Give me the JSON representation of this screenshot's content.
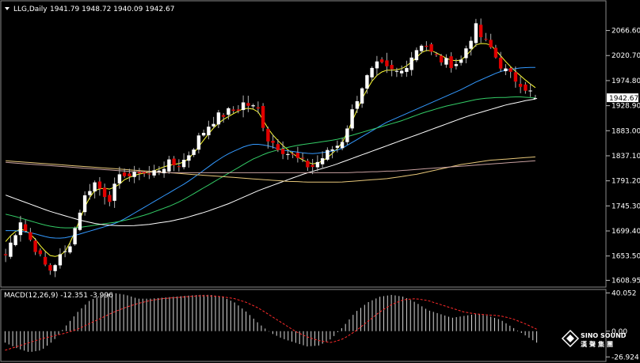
{
  "chart_data": [
    {
      "type": "candlestick",
      "symbol": "LLG,Daily",
      "ohlc_header": "1941.79 1948.72 1940.09 1942.67",
      "ohlc": {
        "open": 1941.79,
        "high": 1948.72,
        "low": 1940.09,
        "close": 1942.67
      },
      "current_price": "1942.67",
      "y_ticks": [
        "2066.60",
        "2020.70",
        "1974.80",
        "1928.90",
        "1883.00",
        "1837.10",
        "1791.20",
        "1745.30",
        "1699.40",
        "1653.50",
        "1608.95"
      ],
      "ylim": [
        1600.9,
        2093.5
      ],
      "bar_count": 108,
      "close_path": [
        1655,
        1688,
        1720,
        1690,
        1668,
        1640,
        1628,
        1648,
        1660,
        1690,
        1740,
        1775,
        1788,
        1770,
        1760,
        1790,
        1808,
        1795,
        1812,
        1802,
        1808,
        1818,
        1822,
        1820,
        1830,
        1850,
        1872,
        1890,
        1905,
        1912,
        1918,
        1922,
        1935,
        1926,
        1920,
        1870,
        1860,
        1850,
        1840,
        1832,
        1822,
        1816,
        1828,
        1840,
        1852,
        1862,
        1900,
        1940,
        1972,
        1990,
        2005,
        1995,
        1990,
        1990,
        2012,
        2032,
        2048,
        2025,
        2015,
        2008,
        2006,
        2010,
        2045,
        2072,
        2048,
        2035,
        2010,
        1992,
        1980,
        1972,
        1958,
        1942.67
      ],
      "candle_colors": {
        "up": "#ffffff",
        "down": "#e00000",
        "wick": "#b0b0b0"
      },
      "moving_averages": [
        {
          "color": "#ffff33",
          "values": [
            1680,
            1696,
            1703,
            1698,
            1684,
            1666,
            1654,
            1652,
            1662,
            1688,
            1722,
            1756,
            1774,
            1778,
            1776,
            1782,
            1794,
            1800,
            1804,
            1806,
            1810,
            1816,
            1820,
            1822,
            1826,
            1838,
            1856,
            1874,
            1890,
            1902,
            1910,
            1918,
            1924,
            1924,
            1916,
            1890,
            1872,
            1858,
            1846,
            1836,
            1828,
            1822,
            1824,
            1832,
            1844,
            1858,
            1886,
            1918,
            1948,
            1972,
            1988,
            1994,
            1994,
            1996,
            2004,
            2016,
            2030,
            2030,
            2024,
            2016,
            2011,
            2012,
            2024,
            2040,
            2044,
            2040,
            2026,
            2010,
            1996,
            1984,
            1972,
            1962
          ]
        },
        {
          "color": "#3399ff",
          "values": [
            1700,
            1700,
            1699,
            1697,
            1694,
            1690,
            1687,
            1686,
            1687,
            1690,
            1694,
            1698,
            1702,
            1706,
            1710,
            1715,
            1722,
            1730,
            1738,
            1746,
            1754,
            1762,
            1770,
            1778,
            1786,
            1795,
            1805,
            1815,
            1825,
            1834,
            1842,
            1848,
            1854,
            1858,
            1858,
            1856,
            1852,
            1848,
            1846,
            1844,
            1842,
            1841,
            1842,
            1844,
            1846,
            1850,
            1858,
            1866,
            1874,
            1882,
            1890,
            1898,
            1904,
            1910,
            1916,
            1922,
            1928,
            1934,
            1940,
            1946,
            1952,
            1958,
            1965,
            1972,
            1978,
            1984,
            1990,
            1994,
            1996,
            1998,
            1999,
            1999
          ]
        },
        {
          "color": "#33cc66",
          "values": [
            1730,
            1727,
            1723,
            1719,
            1715,
            1711,
            1708,
            1706,
            1705,
            1705,
            1706,
            1708,
            1710,
            1712,
            1714,
            1716,
            1719,
            1722,
            1726,
            1730,
            1735,
            1740,
            1745,
            1751,
            1758,
            1766,
            1774,
            1782,
            1790,
            1798,
            1806,
            1814,
            1822,
            1830,
            1836,
            1842,
            1846,
            1850,
            1853,
            1856,
            1858,
            1860,
            1862,
            1864,
            1866,
            1869,
            1873,
            1877,
            1881,
            1885,
            1889,
            1893,
            1897,
            1901,
            1906,
            1911,
            1916,
            1920,
            1924,
            1928,
            1931,
            1934,
            1937,
            1940,
            1942,
            1943,
            1944,
            1944,
            1945,
            1945,
            1944,
            1943
          ]
        },
        {
          "color": "#ffffff",
          "values": [
            1765,
            1760,
            1755,
            1750,
            1745,
            1740,
            1735,
            1731,
            1727,
            1723,
            1719,
            1716,
            1713,
            1711,
            1710,
            1709,
            1709,
            1709,
            1710,
            1711,
            1713,
            1715,
            1717,
            1720,
            1723,
            1727,
            1731,
            1735,
            1740,
            1745,
            1750,
            1756,
            1762,
            1768,
            1774,
            1779,
            1784,
            1789,
            1794,
            1799,
            1804,
            1808,
            1812,
            1816,
            1820,
            1825,
            1830,
            1835,
            1840,
            1845,
            1850,
            1855,
            1860,
            1865,
            1870,
            1875,
            1880,
            1885,
            1890,
            1895,
            1900,
            1905,
            1910,
            1914,
            1918,
            1922,
            1926,
            1930,
            1933,
            1936,
            1939,
            1941
          ]
        },
        {
          "color": "#e8c87a",
          "values": [
            1828,
            1827,
            1826,
            1825,
            1824,
            1823,
            1822,
            1821,
            1820,
            1819,
            1818,
            1817,
            1816,
            1815,
            1814,
            1813,
            1812,
            1811,
            1810,
            1809,
            1808,
            1807,
            1806,
            1805,
            1804,
            1803,
            1802,
            1801,
            1800,
            1799,
            1798,
            1797,
            1796,
            1795,
            1794,
            1793,
            1792,
            1791,
            1790,
            1790,
            1789,
            1789,
            1789,
            1789,
            1789,
            1789,
            1790,
            1791,
            1792,
            1793,
            1794,
            1795,
            1797,
            1799,
            1801,
            1803,
            1806,
            1809,
            1812,
            1815,
            1818,
            1821,
            1823,
            1825,
            1827,
            1829,
            1830,
            1831,
            1832,
            1833,
            1834,
            1835
          ]
        },
        {
          "color": "#c8a0a0",
          "values": [
            1825,
            1824,
            1823,
            1822,
            1821,
            1820,
            1819,
            1818,
            1817,
            1816,
            1815,
            1814,
            1813,
            1812,
            1811,
            1810,
            1809,
            1808,
            1808,
            1807,
            1807,
            1806,
            1806,
            1806,
            1806,
            1806,
            1806,
            1806,
            1806,
            1806,
            1806,
            1806,
            1806,
            1806,
            1806,
            1806,
            1806,
            1806,
            1806,
            1806,
            1806,
            1806,
            1806,
            1806,
            1806,
            1806,
            1806,
            1807,
            1807,
            1808,
            1808,
            1809,
            1809,
            1810,
            1811,
            1812,
            1813,
            1814,
            1815,
            1816,
            1817,
            1818,
            1819,
            1820,
            1821,
            1822,
            1823,
            1824,
            1825,
            1826,
            1827,
            1828
          ]
        }
      ]
    },
    {
      "type": "macd",
      "label": "MACD(12,26,9) -12.351 -3.996",
      "y_ticks": [
        "40.052",
        "0.00",
        "-26.924"
      ],
      "ylim": [
        -30,
        42
      ],
      "histogram_path": [
        -12,
        -18,
        -22,
        -20,
        -10,
        5,
        20,
        32,
        38,
        40,
        38,
        34,
        34,
        35,
        36,
        37,
        38,
        38,
        36,
        30,
        20,
        8,
        -2,
        -8,
        -12,
        -16,
        -15,
        -8,
        5,
        20,
        30,
        36,
        38,
        36,
        30,
        22,
        18,
        14,
        16,
        18,
        16,
        12,
        4,
        -4,
        -12
      ],
      "signal_path": [
        -20,
        -16,
        -12,
        -8,
        -5,
        -2,
        2,
        8,
        14,
        20,
        25,
        29,
        32,
        34,
        35,
        36,
        37,
        37,
        36,
        34,
        30,
        24,
        16,
        8,
        0,
        -6,
        -10,
        -12,
        -8,
        0,
        10,
        20,
        28,
        33,
        34,
        32,
        28,
        24,
        20,
        18,
        17,
        16,
        13,
        8,
        2
      ]
    }
  ],
  "logo": {
    "name": "SINO SOUND",
    "sub": "漢聲集團"
  },
  "colors": {
    "background": "#000000",
    "frame": "#8a8a8a",
    "macd_hist": "#d8d8d8",
    "macd_signal": "#ff2a2a",
    "price_box": "#ffffff"
  }
}
